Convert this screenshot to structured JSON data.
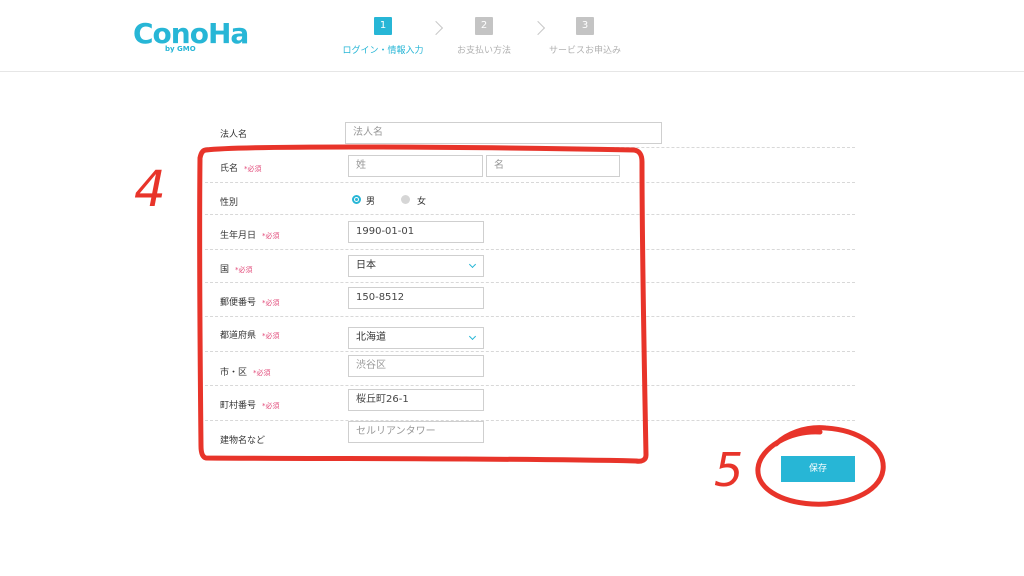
{
  "header": {
    "logo_text": "ConoHa",
    "logo_sub": "by GMO",
    "steps": [
      {
        "num": "1",
        "label": "ログイン・情報入力"
      },
      {
        "num": "2",
        "label": "お支払い方法"
      },
      {
        "num": "3",
        "label": "サービスお申込み"
      }
    ]
  },
  "form": {
    "required_mark": "*必須",
    "corporate_name": {
      "label": "法人名",
      "placeholder": "法人名"
    },
    "name": {
      "label": "氏名",
      "last_placeholder": "姓",
      "first_placeholder": "名"
    },
    "gender": {
      "label": "性別",
      "male": "男",
      "female": "女",
      "selected": "男"
    },
    "birthdate": {
      "label": "生年月日",
      "value": "1990-01-01"
    },
    "country": {
      "label": "国",
      "value": "日本"
    },
    "postal_code": {
      "label": "郵便番号",
      "value": "150-8512"
    },
    "prefecture": {
      "label": "都道府県",
      "value": "北海道"
    },
    "city": {
      "label": "市・区",
      "value": "渋谷区"
    },
    "town": {
      "label": "町村番号",
      "value": "桜丘町26-1"
    },
    "building": {
      "label": "建物名など",
      "value": "セルリアンタワー"
    }
  },
  "save_label": "保存",
  "annotations": {
    "box_number": "4",
    "button_number": "5",
    "color": "#e8342a"
  },
  "colors": {
    "accent": "#27b6d6",
    "required": "#e24a79"
  }
}
